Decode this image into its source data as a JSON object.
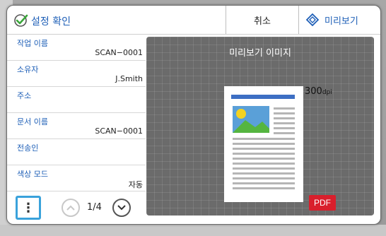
{
  "header": {
    "title": "설정 확인",
    "cancel_label": "취소",
    "preview_label": "미리보기"
  },
  "settings": [
    {
      "label": "작업 이름",
      "value": "SCAN−0001"
    },
    {
      "label": "소유자",
      "value": "J.Smith"
    },
    {
      "label": "주소",
      "value": ""
    },
    {
      "label": "문서 이름",
      "value": "SCAN−0001"
    },
    {
      "label": "전송인",
      "value": ""
    },
    {
      "label": "색상 모드",
      "value": "자동"
    }
  ],
  "pager": {
    "page_indicator": "1/4",
    "menu_glyph": "⋮",
    "up_icon": "chevron-up-icon",
    "down_icon": "chevron-down-icon"
  },
  "preview": {
    "title": "미리보기 이미지",
    "dpi_value": "300",
    "dpi_unit": "dpi",
    "format_badge": "PDF"
  },
  "colors": {
    "accent": "#1e5fb7",
    "highlight": "#3aa2db",
    "pdf_badge": "#d91f2c",
    "check": "#3aa63a"
  }
}
